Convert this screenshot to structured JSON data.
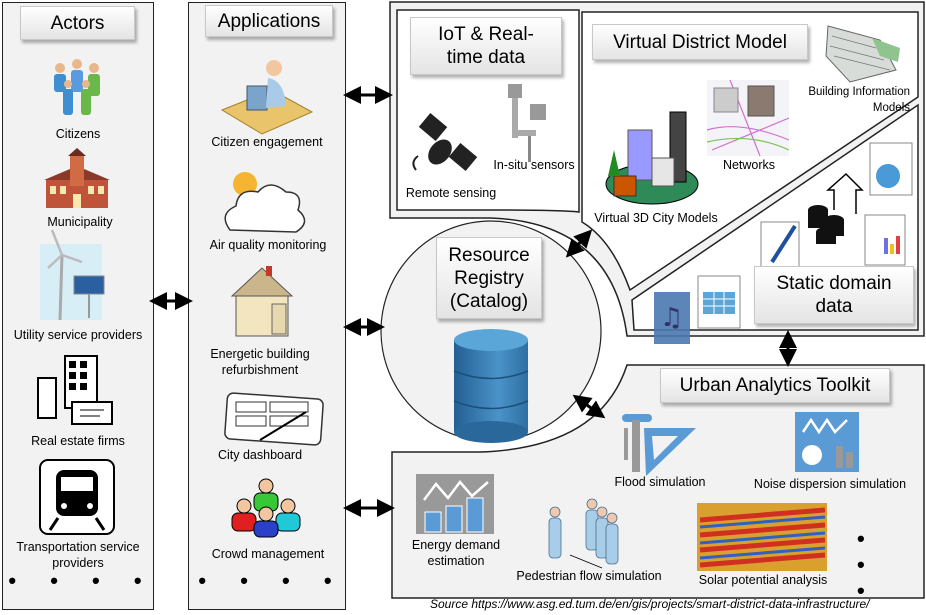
{
  "actors": {
    "title": "Actors",
    "items": [
      {
        "label": "Citizens",
        "icon": "people-icon"
      },
      {
        "label": "Municipality",
        "icon": "town-hall-icon"
      },
      {
        "label": "Utility service providers",
        "icon": "wind-solar-icon"
      },
      {
        "label": "Real estate firms",
        "icon": "buildings-icon"
      },
      {
        "label": "Transportation service providers",
        "icon": "train-icon"
      }
    ],
    "more": "• • • •"
  },
  "applications": {
    "title": "Applications",
    "items": [
      {
        "label": "Citizen engagement",
        "icon": "computer-user-icon"
      },
      {
        "label": "Air quality monitoring",
        "icon": "sun-cloud-icon"
      },
      {
        "label": "Energetic building refurbishment",
        "icon": "house-icon"
      },
      {
        "label": "City dashboard",
        "icon": "tablet-dashboard-icon"
      },
      {
        "label": "Crowd management",
        "icon": "crowd-icon"
      }
    ],
    "more": "• • • •"
  },
  "iot": {
    "title": "IoT & Real-time data",
    "items": [
      {
        "label": "Remote sensing",
        "icon": "satellite-icon"
      },
      {
        "label": "In-situ sensors",
        "icon": "weather-station-icon"
      }
    ]
  },
  "virtual_district_model": {
    "title": "Virtual District Model",
    "items": [
      {
        "label": "Building Information Models",
        "icon": "bim-building-icon"
      },
      {
        "label": "Networks",
        "icon": "network-map-icon"
      },
      {
        "label": "Virtual 3D City Models",
        "icon": "city-3d-icon"
      }
    ]
  },
  "static_domain_data": {
    "title": "Static domain data"
  },
  "resource_registry": {
    "title": "Resource Registry (Catalog)",
    "icon": "database-icon"
  },
  "urban_analytics": {
    "title": "Urban Analytics Toolkit",
    "items": [
      {
        "label": "Flood simulation",
        "icon": "ruler-triangle-icon"
      },
      {
        "label": "Noise dispersion simulation",
        "icon": "analytics-chart-icon"
      },
      {
        "label": "Energy demand estimation",
        "icon": "bar-trend-icon"
      },
      {
        "label": "Pedestrian flow simulation",
        "icon": "pedestrians-icon"
      },
      {
        "label": "Solar potential analysis",
        "icon": "solar-map-icon"
      }
    ],
    "more": "• • •"
  },
  "source": "Source https://www.asg.ed.tum.de/en/gis/projects/smart-district-data-infrastructure/",
  "colors": {
    "panel": "#f2f2f2",
    "accent_blue": "#5b9bd5",
    "database": "#3a7fb5"
  }
}
